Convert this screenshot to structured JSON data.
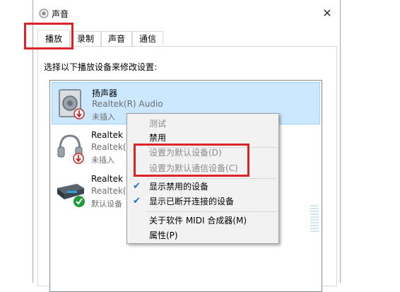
{
  "window": {
    "title": "声音",
    "close_glyph": "✕"
  },
  "tabs": [
    {
      "label": "播放",
      "active": true
    },
    {
      "label": "录制"
    },
    {
      "label": "声音"
    },
    {
      "label": "通信"
    }
  ],
  "instruction": "选择以下播放设备来修改设置:",
  "devices": [
    {
      "name": "扬声器",
      "driver": "Realtek(R) Audio",
      "status": "未插入",
      "icon": "speaker-icon",
      "badge": "down-arrow-badge-icon",
      "selected": true
    },
    {
      "name": "Realtek H",
      "driver": "Realtek(R",
      "status": "未插入",
      "icon": "headphones-icon",
      "badge": "down-arrow-badge-icon"
    },
    {
      "name": "Realtek D",
      "driver": "Realtek(R",
      "status": "默认设备",
      "icon": "digital-output-icon",
      "badge": "green-check-badge-icon"
    }
  ],
  "context_menu": {
    "items": [
      {
        "label": "测试",
        "disabled": true
      },
      {
        "label": "禁用"
      },
      {
        "label": "设置为默认设备(D)",
        "disabled": true
      },
      {
        "label": "设置为默认通信设备(C)",
        "disabled": true
      },
      {
        "label": "显示禁用的设备",
        "checked": true
      },
      {
        "label": "显示已断开连接的设备",
        "checked": true
      },
      {
        "label": "关于软件 MIDI 合成器(M)"
      },
      {
        "label": "属性(P)"
      }
    ]
  },
  "colors": {
    "highlight": "#d9252a",
    "selection": "#cce8ff",
    "check": "#1a6fc4"
  }
}
